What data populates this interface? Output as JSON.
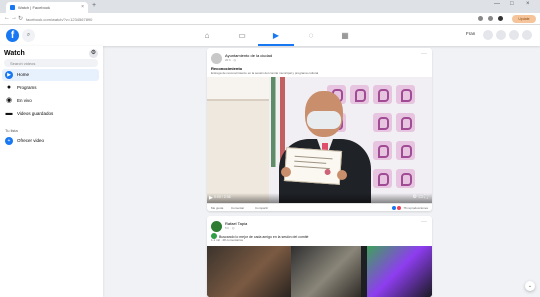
{
  "browser": {
    "tab_title": "Watch | Facebook",
    "close_label": "×",
    "new_tab_label": "+",
    "address": "facebook.com/watch/?v=1234567890",
    "back_label": "←",
    "forward_label": "→",
    "reload_label": "↻",
    "update_label": "Update",
    "window_controls": [
      "—",
      "□",
      "×"
    ]
  },
  "header": {
    "logo": "f",
    "search_icon": "⌕",
    "nav_icons": [
      "⌂",
      "▭",
      "▶",
      "◌",
      "▦"
    ],
    "profile_name": "Fran"
  },
  "sidebar": {
    "title": "Watch",
    "gear": "⚙",
    "search_placeholder": "Search videos",
    "items": [
      {
        "label": "Home",
        "icon": "▶"
      },
      {
        "label": "Programs",
        "icon": "●"
      },
      {
        "label": "En vivo",
        "icon": "◉"
      },
      {
        "label": "Videos guardados",
        "icon": "▬"
      }
    ],
    "section_label": "Tu lista",
    "following": "Ofrecer video"
  },
  "post1": {
    "page": "Ayuntamiento de la ciudad",
    "time": "20 h · ◎",
    "title": "Reconocimiento",
    "caption": "Entrega de reconocimiento en la sesión del comité municipal y programa cultural",
    "video_time": "0:00 / 2:36",
    "actions": [
      "Me gusta",
      "Comentar",
      "Compartir"
    ],
    "reactions": "76 reproducciones"
  },
  "post2": {
    "name": "Rafael Tapia",
    "time": "5 h · ◎",
    "line1": "Buscando lo mejor de cada amigo en la sesión del comité",
    "line2": "1.1 mil · 28 comentarios"
  },
  "video_time_labels": [
    "▶",
    "0:00"
  ],
  "icons": {
    "more": "···",
    "scroll_down": "⌄"
  }
}
